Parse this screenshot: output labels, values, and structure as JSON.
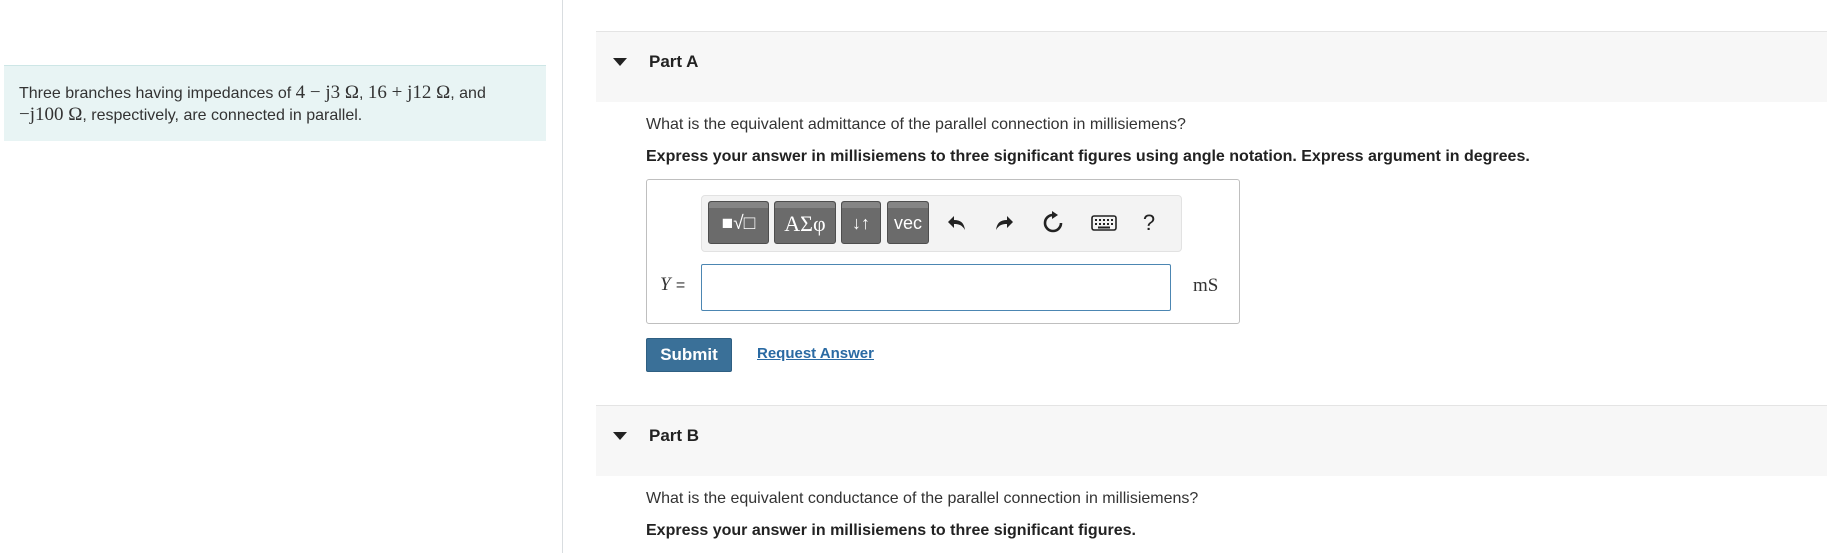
{
  "problem": {
    "text_before": "Three branches having impedances of ",
    "z1": "4 − j3 Ω",
    "sep1": ", ",
    "z2": "16 + j12 Ω",
    "sep2": ", and",
    "z3": "−j100 Ω",
    "text_after": ", respectively, are connected in parallel."
  },
  "part_a": {
    "title": "Part A",
    "question": "What is the equivalent admittance of the parallel connection in millisiemens?",
    "instruction": "Express your answer in millisiemens to three significant figures using angle notation. Express argument in degrees.",
    "toolbar": {
      "template_icon": "■√□",
      "greek_label": "ΑΣφ",
      "sort_label": "↓↑",
      "vec_label": "vec",
      "undo_icon": "undo-icon",
      "redo_icon": "redo-icon",
      "reset_icon": "reset-icon",
      "keyboard_icon": "keyboard-icon",
      "help_label": "?"
    },
    "variable": "Y",
    "equals": "=",
    "input_value": "",
    "unit": "mS",
    "submit_label": "Submit",
    "request_answer_label": "Request Answer"
  },
  "part_b": {
    "title": "Part B",
    "question": "What is the equivalent conductance of the parallel connection in millisiemens?",
    "instruction": "Express your answer in millisiemens to three significant figures."
  },
  "colors": {
    "problem_bg": "#e8f4f4",
    "submit_bg": "#3a7098",
    "link": "#2a6aa3",
    "input_border": "#4c86b2"
  }
}
